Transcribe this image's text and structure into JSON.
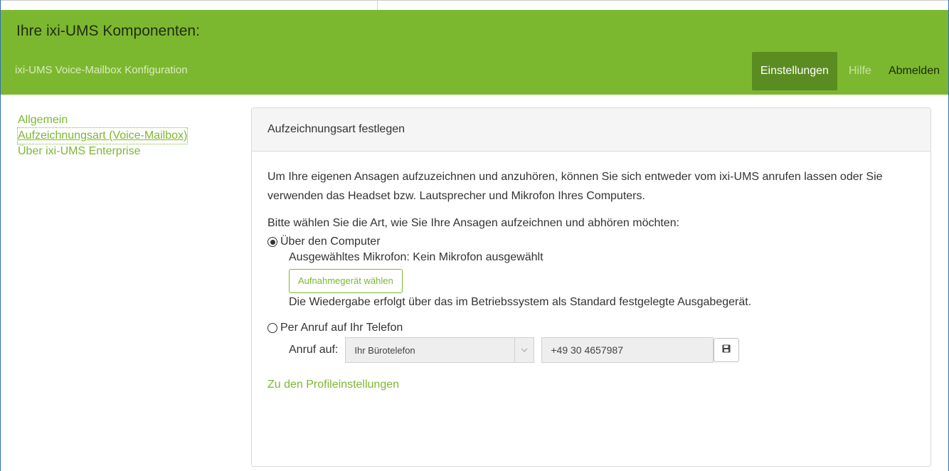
{
  "header": {
    "title": "Ihre ixi-UMS Komponenten:",
    "subtitle": "ixi-UMS Voice-Mailbox Konfiguration",
    "nav": {
      "settings": "Einstellungen",
      "help": "Hilfe",
      "logout": "Abmelden"
    }
  },
  "sidebar": {
    "items": [
      {
        "label": "Allgemein"
      },
      {
        "label": "Aufzeichnungsart (Voice-Mailbox)"
      },
      {
        "label": "Über ixi-UMS Enterprise"
      }
    ]
  },
  "panel": {
    "title": "Aufzeichnungsart festlegen",
    "intro": "Um Ihre eigenen Ansagen aufzuzeichnen und anzuhören, können Sie sich entweder vom ixi-UMS anrufen lassen oder Sie verwenden das Headset bzw. Lautsprecher und Mikrofon Ihres Computers.",
    "prompt": "Bitte wählen Sie die Art, wie Sie Ihre Ansagen aufzeichnen und abhören möchten:",
    "option_computer": {
      "label": "Über den Computer",
      "selected": true,
      "mic_text": "Ausgewähltes Mikrofon: Kein Mikrofon ausgewählt",
      "button": "Aufnahmegerät wählen",
      "playback_text": "Die Wiedergabe erfolgt über das im Betriebssystem als Standard festgelegte Ausgabegerät."
    },
    "option_phone": {
      "label": "Per Anruf auf Ihr Telefon",
      "selected": false,
      "call_label": "Anruf auf:",
      "select_value": "Ihr Bürotelefon",
      "phone_number": "+49 30 4657987"
    },
    "profile_link": "Zu den Profileinstellungen"
  },
  "colors": {
    "header_green": "#7cb82f",
    "active_nav": "#5b8c22",
    "link_green": "#7cb82f"
  },
  "icons": {
    "save": "floppy-disk-icon",
    "dropdown": "chevron-down-icon"
  }
}
